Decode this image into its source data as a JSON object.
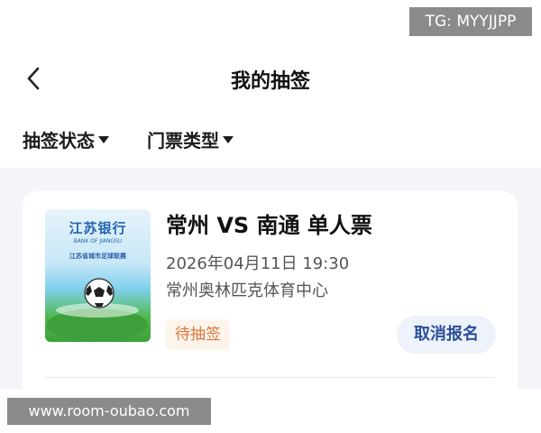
{
  "watermarks": {
    "top_right": "TG: MYYJJPP",
    "bottom_left": "www.room-oubao.com"
  },
  "header": {
    "title": "我的抽签",
    "back_icon": "chevron-left-icon"
  },
  "filters": [
    {
      "label": "抽签状态",
      "icon": "caret-down-icon"
    },
    {
      "label": "门票类型",
      "icon": "caret-down-icon"
    }
  ],
  "ticket": {
    "title": "常州 VS 南通 单人票",
    "datetime": "2026年04月11日 19:30",
    "venue": "常州奥林匹克体育中心",
    "status": "待抽签",
    "cancel_label": "取消报名",
    "poster": {
      "bank_cn": "江苏银行",
      "bank_en": "BANK OF JIANGSU",
      "league": "江苏省城市足球联赛"
    }
  },
  "colors": {
    "status_text": "#d9773a",
    "status_bg": "#fdf4ec",
    "cancel_text": "#2a4f9a",
    "cancel_bg": "#eef2fa",
    "page_bg": "#f4f5f8"
  }
}
